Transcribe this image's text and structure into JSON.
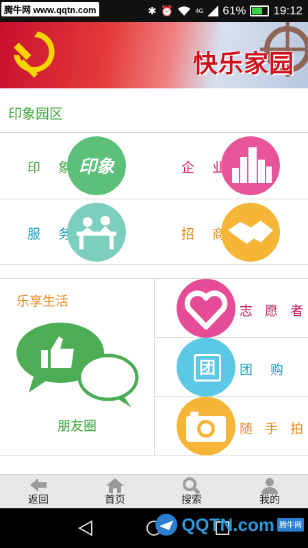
{
  "status_bar": {
    "watermark": "腾牛网 www.qqtn.com",
    "network": "4G",
    "battery": "61%",
    "time": "19:12"
  },
  "banner": {
    "title": "快乐家园"
  },
  "section": {
    "title": "印象园区"
  },
  "grid": [
    {
      "label": "印 象",
      "icon": "yinxiang-icon",
      "color": "#5cc07a",
      "icon_text": "印象"
    },
    {
      "label": "企 业",
      "icon": "buildings-icon",
      "color": "#e8559a"
    },
    {
      "label": "服 务",
      "icon": "service-desk-icon",
      "color": "#7dcfbd"
    },
    {
      "label": "招 商",
      "icon": "handshake-icon",
      "color": "#f5b638"
    }
  ],
  "life": {
    "title": "乐享生活",
    "moments_label": "朋友圈",
    "items": [
      {
        "label": "志 愿 者",
        "icon": "heart-hand-icon",
        "color": "#e64b97"
      },
      {
        "label": "团 购",
        "icon": "group-buy-icon",
        "color": "#5bc8e6",
        "icon_text": "团"
      },
      {
        "label": "随 手 拍",
        "icon": "camera-icon",
        "color": "#f5b638"
      }
    ]
  },
  "bottom_nav": [
    {
      "label": "返回",
      "icon": "back-arrow-icon"
    },
    {
      "label": "首页",
      "icon": "home-icon"
    },
    {
      "label": "搜索",
      "icon": "search-icon"
    },
    {
      "label": "我的",
      "icon": "user-icon"
    }
  ],
  "system_nav": {
    "watermark_brand": "QQTN.com",
    "watermark_cn": "腾牛网"
  },
  "colors": {
    "green": "#3aa33a",
    "red": "#d0101a",
    "pink_label": "#d81b60",
    "teal_label": "#19a0c0",
    "orange_label": "#e88a20"
  }
}
